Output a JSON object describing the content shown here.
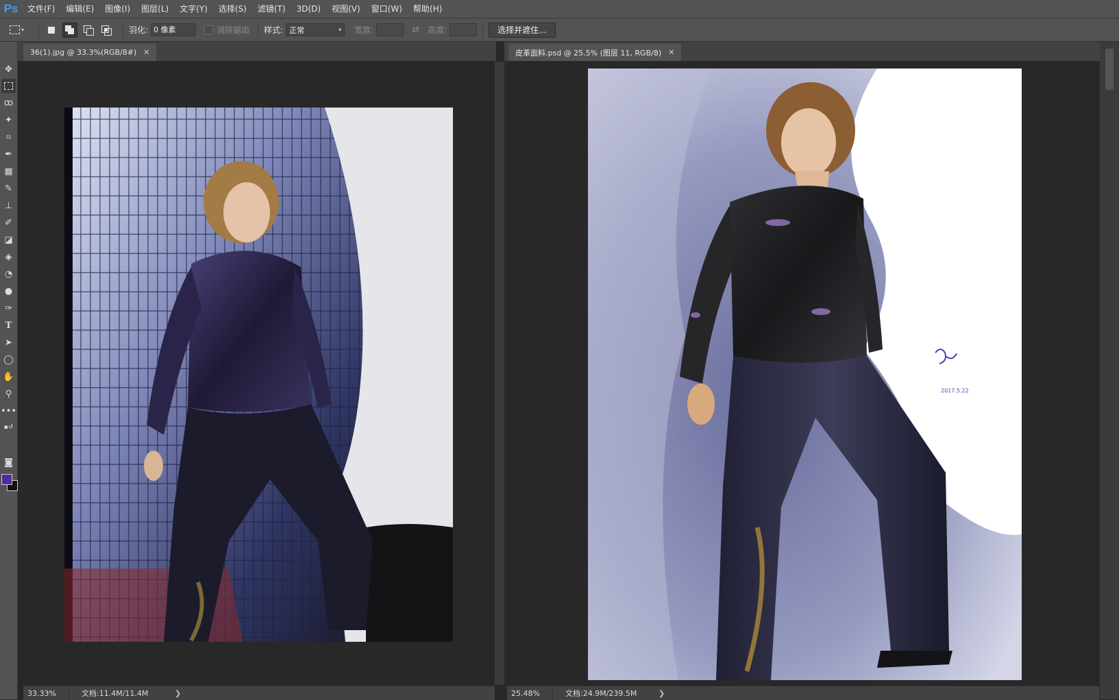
{
  "app": {
    "logo": "Ps"
  },
  "menu": [
    "文件(F)",
    "编辑(E)",
    "图像(I)",
    "图层(L)",
    "文字(Y)",
    "选择(S)",
    "滤镜(T)",
    "3D(D)",
    "视图(V)",
    "窗口(W)",
    "帮助(H)"
  ],
  "options": {
    "feather_label": "羽化:",
    "feather_value": "0 像素",
    "antialias_label": "消除锯齿",
    "style_label": "样式:",
    "style_value": "正常",
    "width_label": "宽度:",
    "height_label": "高度:",
    "select_mask_button": "选择并遮住..."
  },
  "documents": [
    {
      "tab": "36(1).jpg @ 33.3%(RGB/8#)",
      "zoom": "33.33%",
      "doc_info": "文档:11.4M/11.4M"
    },
    {
      "tab": "皮革面料.psd @ 25.5% (图层 11, RGB/8)",
      "zoom": "25.48%",
      "doc_info": "文档:24.9M/239.5M"
    }
  ],
  "colors": {
    "foreground": "#4e2c9a",
    "background": "#111111",
    "accent": "#3c9cff"
  },
  "signature": "2017.5.22"
}
